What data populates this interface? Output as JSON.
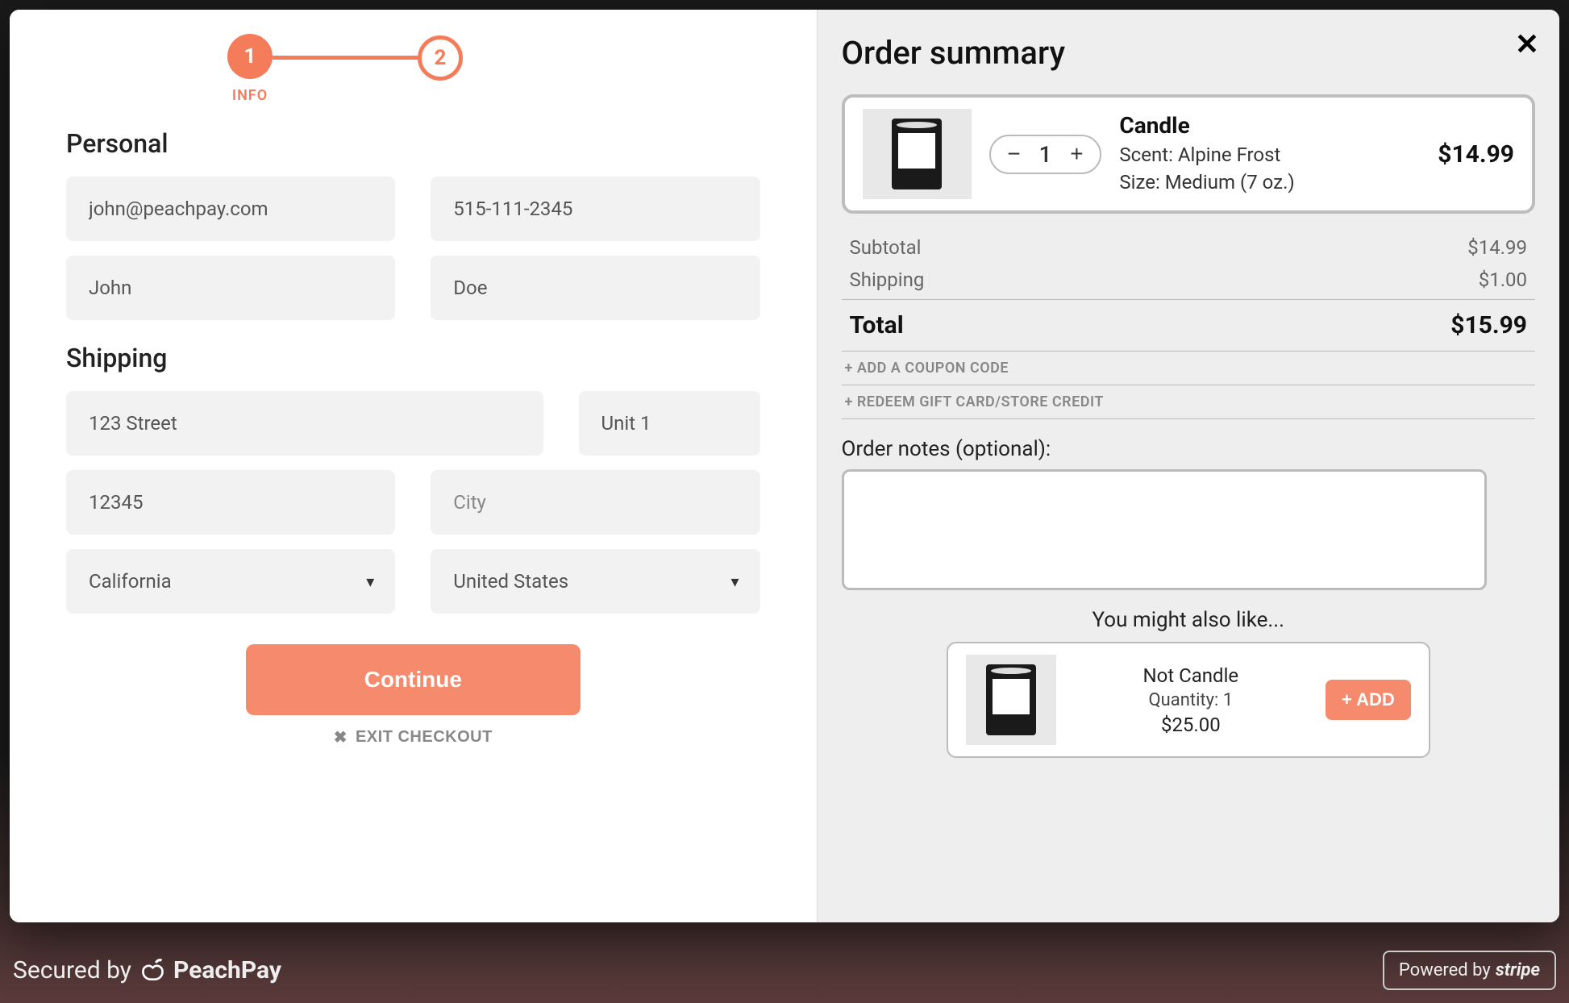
{
  "stepper": {
    "step1_number": "1",
    "step1_label": "INFO",
    "step2_number": "2"
  },
  "form": {
    "personal_heading": "Personal",
    "email": "john@peachpay.com",
    "phone": "515-111-2345",
    "first_name": "John",
    "last_name": "Doe",
    "shipping_heading": "Shipping",
    "street": "123 Street",
    "unit": "Unit 1",
    "postal": "12345",
    "city_placeholder": "City",
    "state": "California",
    "country": "United States",
    "continue_label": "Continue",
    "exit_label": "EXIT CHECKOUT"
  },
  "summary": {
    "title": "Order summary",
    "product": {
      "name": "Candle",
      "quantity": "1",
      "scent_label": "Scent: Alpine Frost",
      "size_label": "Size: Medium (7 oz.)",
      "price": "$14.99"
    },
    "subtotal_label": "Subtotal",
    "subtotal_value": "$14.99",
    "shipping_label": "Shipping",
    "shipping_value": "$1.00",
    "total_label": "Total",
    "total_value": "$15.99",
    "coupon_link": "+ ADD A COUPON CODE",
    "giftcard_link": "+ REDEEM GIFT CARD/STORE CREDIT",
    "notes_label": "Order notes (optional):",
    "suggest_title": "You might also like...",
    "suggestion": {
      "name": "Not Candle",
      "quantity_label": "Quantity: 1",
      "price": "$25.00",
      "add_label": "+ ADD"
    }
  },
  "footer": {
    "secured_label": "Secured by",
    "brand": "PeachPay",
    "powered_label": "Powered by",
    "stripe": "stripe"
  }
}
